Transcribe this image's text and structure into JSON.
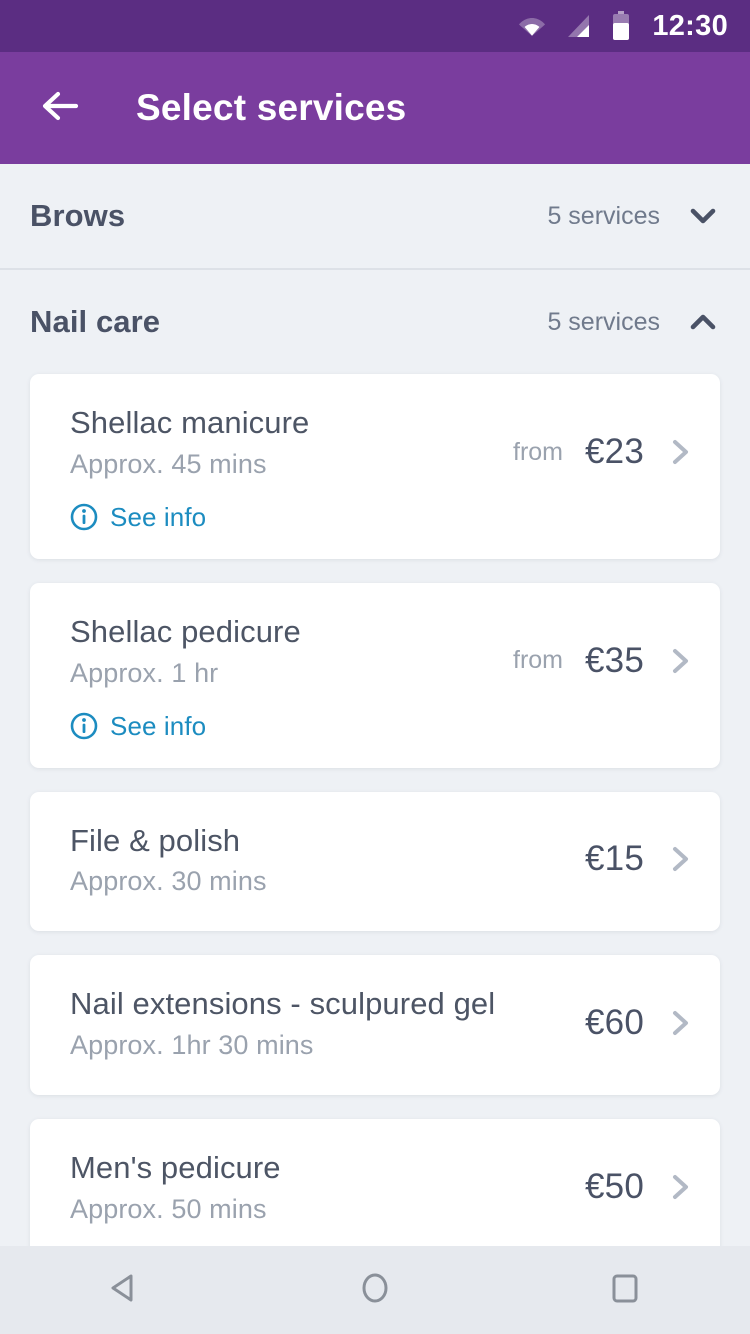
{
  "status_bar": {
    "time": "12:30",
    "icons": [
      "wifi-icon",
      "signal-icon",
      "battery-icon"
    ]
  },
  "app_bar": {
    "back_icon": "back-arrow-icon",
    "title": "Select services"
  },
  "colors": {
    "status_bar_bg": "#5b2d82",
    "app_bar_bg": "#7a3d9e",
    "page_bg": "#eef1f5",
    "card_bg": "#ffffff",
    "heading_text": "#4a5266",
    "muted_text": "#9aa2ae",
    "link_accent": "#1c8cc0",
    "chevron_muted": "#b2b9c5",
    "divider": "#dde1e7"
  },
  "categories": [
    {
      "name": "Brows",
      "count_label": "5 services",
      "expanded": false,
      "toggle_icon": "chevron-down-icon",
      "services": []
    },
    {
      "name": "Nail care",
      "count_label": "5 services",
      "expanded": true,
      "toggle_icon": "chevron-up-icon",
      "services": [
        {
          "title": "Shellac manicure",
          "duration": "Approx. 45 mins",
          "price_prefix": "from",
          "price": "€23",
          "see_info_label": "See info",
          "has_info": true,
          "chevron_icon": "chevron-right-icon"
        },
        {
          "title": "Shellac pedicure",
          "duration": "Approx. 1 hr",
          "price_prefix": "from",
          "price": "€35",
          "see_info_label": "See info",
          "has_info": true,
          "chevron_icon": "chevron-right-icon"
        },
        {
          "title": "File & polish",
          "duration": "Approx. 30 mins",
          "price_prefix": "",
          "price": "€15",
          "see_info_label": "",
          "has_info": false,
          "chevron_icon": "chevron-right-icon"
        },
        {
          "title": "Nail extensions - sculpured gel",
          "duration": "Approx. 1hr 30 mins",
          "price_prefix": "",
          "price": "€60",
          "see_info_label": "",
          "has_info": false,
          "chevron_icon": "chevron-right-icon"
        },
        {
          "title": "Men's pedicure",
          "duration": "Approx. 50 mins",
          "price_prefix": "",
          "price": "€50",
          "see_info_label": "",
          "has_info": false,
          "chevron_icon": "chevron-right-icon"
        }
      ]
    }
  ],
  "nav_bar": {
    "back": "nav-back-icon",
    "home": "nav-home-icon",
    "recents": "nav-recents-icon"
  }
}
